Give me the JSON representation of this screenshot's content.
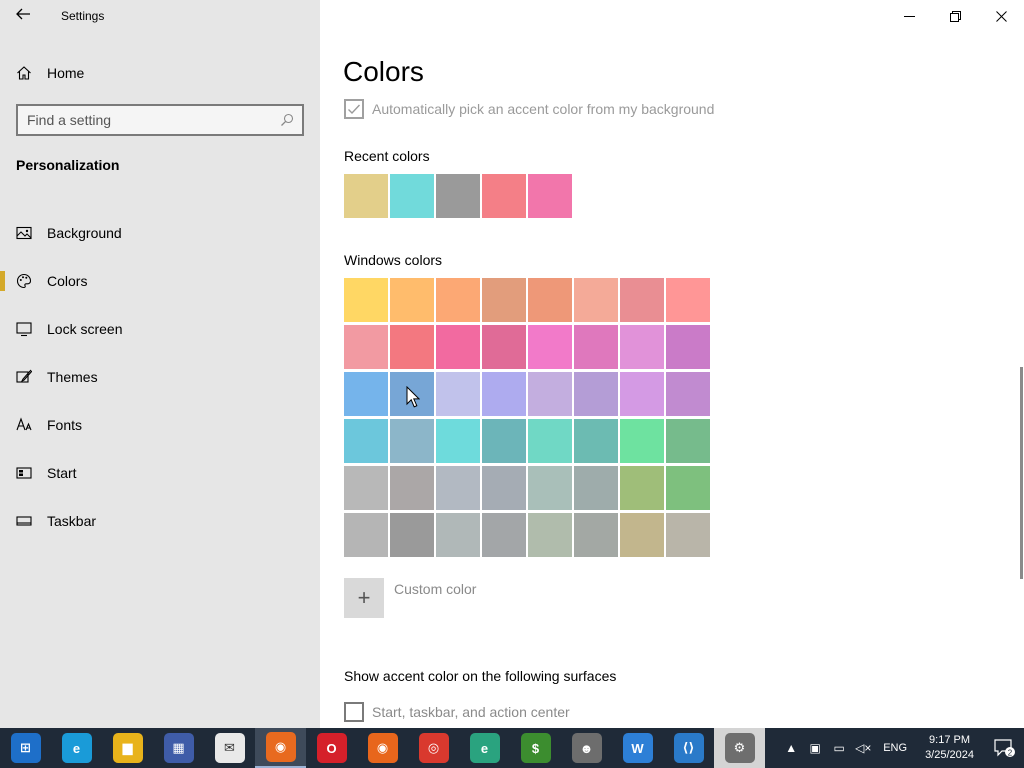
{
  "window": {
    "title": "Settings"
  },
  "sidebar": {
    "home_label": "Home",
    "search_placeholder": "Find a setting",
    "section_heading": "Personalization",
    "items": [
      {
        "label": "Background",
        "icon": "picture-icon",
        "active": false
      },
      {
        "label": "Colors",
        "icon": "palette-icon",
        "active": true
      },
      {
        "label": "Lock screen",
        "icon": "monitor-icon",
        "active": false
      },
      {
        "label": "Themes",
        "icon": "brush-icon",
        "active": false
      },
      {
        "label": "Fonts",
        "icon": "font-icon",
        "active": false
      },
      {
        "label": "Start",
        "icon": "start-tiles-icon",
        "active": false
      },
      {
        "label": "Taskbar",
        "icon": "taskbar-icon",
        "active": false
      }
    ]
  },
  "main": {
    "title": "Colors",
    "auto_pick_label": "Automatically pick an accent color from my background",
    "auto_pick_checked": true,
    "recent_label": "Recent colors",
    "recent_colors": [
      "#e3cf8a",
      "#71dadb",
      "#9a9a9a",
      "#f47f87",
      "#f276ab"
    ],
    "windows_label": "Windows colors",
    "windows_colors": [
      [
        "#ffd764",
        "#ffbc6c",
        "#fca874",
        "#e29d7c",
        "#ee9878",
        "#f4aa98",
        "#e98e93",
        "#ff9696"
      ],
      [
        "#f29aa2",
        "#f37880",
        "#f26aa0",
        "#e06b97",
        "#f27ac9",
        "#df78bd",
        "#e192d9",
        "#ca7bc8"
      ],
      [
        "#75b4eb",
        "#77a6d6",
        "#c1c2eb",
        "#aeabef",
        "#c3aedf",
        "#b49dd6",
        "#d49ae4",
        "#c18bd0"
      ],
      [
        "#6cc7dc",
        "#8cb6c9",
        "#6edbdc",
        "#6cb5b9",
        "#70d8c5",
        "#6cbbb2",
        "#6ee2a0",
        "#76bb8c"
      ],
      [
        "#b8b8b8",
        "#aba7a7",
        "#b2b9c2",
        "#a5acb4",
        "#a9bfb9",
        "#9eacab",
        "#9fbe79",
        "#7ec07e"
      ],
      [
        "#b5b5b5",
        "#9a9a9a",
        "#b0b8b8",
        "#a3a6a8",
        "#b0bcac",
        "#a3a8a4",
        "#c2b68d",
        "#b9b5a9"
      ]
    ],
    "custom_color_label": "Custom color",
    "surfaces_label": "Show accent color on the following surfaces",
    "surfaces_option_label": "Start, taskbar, and action center"
  },
  "taskbar": {
    "apps": [
      {
        "name": "start-button",
        "color": "#1e6fc9",
        "glyph": "⊞"
      },
      {
        "name": "edge",
        "color": "#1a9bd8",
        "glyph": "e"
      },
      {
        "name": "file-explorer",
        "color": "#e8b31b",
        "glyph": "▆"
      },
      {
        "name": "microsoft-store",
        "color": "#3f5ca8",
        "glyph": "▦"
      },
      {
        "name": "mail",
        "color": "#e9e9e9",
        "glyph": "✉"
      },
      {
        "name": "firefox-active",
        "color": "#e86a1f",
        "glyph": "◉"
      },
      {
        "name": "opera",
        "color": "#d5202a",
        "glyph": "O"
      },
      {
        "name": "firefox",
        "color": "#e8661c",
        "glyph": "◉"
      },
      {
        "name": "chrome",
        "color": "#d9392e",
        "glyph": "◎"
      },
      {
        "name": "edge-dev",
        "color": "#2aa37f",
        "glyph": "e"
      },
      {
        "name": "money-app",
        "color": "#3c8d2f",
        "glyph": "$"
      },
      {
        "name": "raccoon-app",
        "color": "#6d6d6d",
        "glyph": "☻"
      },
      {
        "name": "w-app",
        "color": "#2d7fd6",
        "glyph": "W"
      },
      {
        "name": "vscode",
        "color": "#2a7ac9",
        "glyph": "⟨⟩"
      },
      {
        "name": "settings",
        "color": "#6e6e6e",
        "glyph": "⚙"
      }
    ],
    "language": "ENG",
    "time": "9:17 PM",
    "date": "3/25/2024",
    "notification_count": "2"
  }
}
